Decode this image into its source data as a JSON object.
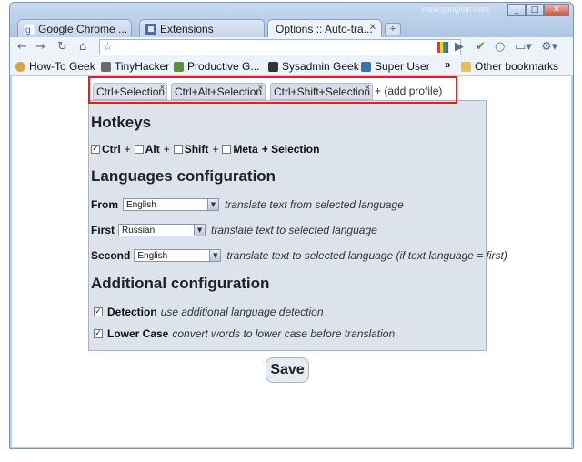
{
  "window": {
    "watermark": "www.googlein.com",
    "controls": [
      "_",
      "□",
      "✕"
    ]
  },
  "tabs": [
    {
      "label": "Google Chrome ...",
      "active": false
    },
    {
      "label": "Extensions",
      "active": false
    },
    {
      "label": "Options :: Auto-tra...",
      "active": true
    }
  ],
  "bookmarks": [
    {
      "label": "How-To Geek",
      "color": "#d9a441"
    },
    {
      "label": "TinyHacker",
      "color": "#6b6b6b"
    },
    {
      "label": "Productive G...",
      "color": "#5a8f3c"
    },
    {
      "label": "Sysadmin Geek",
      "color": "#333333"
    },
    {
      "label": "Super User",
      "color": "#3a6fb0"
    },
    {
      "label": "Other bookmarks",
      "color": "#e5c05a"
    }
  ],
  "profiles": [
    {
      "label": "Ctrl+Selection",
      "close": "×"
    },
    {
      "label": "Ctrl+Alt+Selection",
      "close": "×"
    },
    {
      "label": "Ctrl+Shift+Selection",
      "close": "×"
    }
  ],
  "add_profile": "+ (add profile)",
  "hotkeys": {
    "title": "Hotkeys",
    "ctrl": "Ctrl",
    "alt": "Alt",
    "shift": "Shift",
    "meta": "Meta",
    "plus": "+",
    "selection": "+ Selection",
    "ctrl_checked": "✓"
  },
  "languages": {
    "title": "Languages configuration",
    "from_label": "From",
    "from_value": "English",
    "from_hint": "translate text from selected language",
    "first_label": "First",
    "first_value": "Russian",
    "first_hint": "translate text to selected language",
    "second_label": "Second",
    "second_value": "English",
    "second_hint": "translate text to selected language (if text language = first)"
  },
  "additional": {
    "title": "Additional configuration",
    "detection_label": "Detection",
    "detection_hint": "use additional language detection",
    "lowercase_label": "Lower Case",
    "lowercase_hint": "convert words to lower case before translation",
    "checked": "✓"
  },
  "save_label": "Save"
}
